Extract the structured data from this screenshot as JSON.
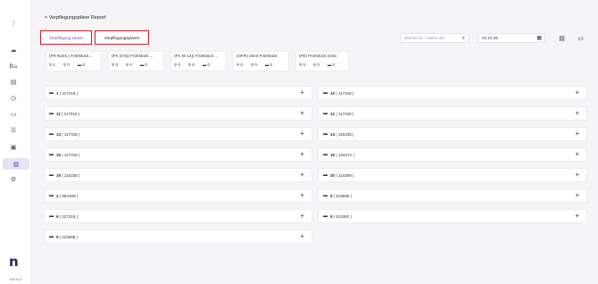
{
  "sidebar": {
    "icons": [
      "more-vertical-icon",
      "cloud-icon",
      "bed-icon",
      "clipboard-icon",
      "clock-icon",
      "chat-icon",
      "list-icon",
      "contact-icon",
      "chart-icon",
      "gear-icon"
    ],
    "logo": "n",
    "version": "v11.6.2"
  },
  "header": {
    "title": "< Verpflegungspläne Report",
    "tab_today": "Verpflegung Heute",
    "tab_planner": "Verpflegungsplaner",
    "search_placeholder": "Zimmer Nr. / Name des",
    "date_value": "24.10.25"
  },
  "categories": [
    {
      "name": "(FR Norm.) Frühstück...",
      "adults": "1",
      "kids": "0",
      "beds": "0"
    },
    {
      "name": "(FK (0-5)) Frühstück ...",
      "adults": "0",
      "kids": "0",
      "beds": "0"
    },
    {
      "name": "(FK (6-12)) Frühstück ...",
      "adults": "0",
      "kids": "0",
      "beds": "0"
    },
    {
      "name": "(OFR) ohne Frühstück",
      "adults": "0",
      "kids": "0",
      "beds": "0"
    },
    {
      "name": "(FE) Frühstück extra",
      "adults": "0",
      "kids": "0",
      "beds": "0"
    }
  ],
  "rooms_left": [
    {
      "num": "1",
      "code": "117316"
    },
    {
      "num": "11",
      "code": "117316"
    },
    {
      "num": "13",
      "code": "117316"
    },
    {
      "num": "15",
      "code": "117316"
    },
    {
      "num": "19",
      "code": "116235"
    },
    {
      "num": "4",
      "code": "994309"
    },
    {
      "num": "6",
      "code": "117316"
    },
    {
      "num": "9",
      "code": "115888"
    }
  ],
  "rooms_right": [
    {
      "num": "10",
      "code": "117316"
    },
    {
      "num": "12",
      "code": "117316"
    },
    {
      "num": "14",
      "code": "116235"
    },
    {
      "num": "16",
      "code": "120471"
    },
    {
      "num": "20",
      "code": "114309"
    },
    {
      "num": "5",
      "code": "118595"
    },
    {
      "num": "9",
      "code": "110382"
    }
  ],
  "colors": {
    "highlight": "#d8182b",
    "accent": "#6c4bd0"
  }
}
